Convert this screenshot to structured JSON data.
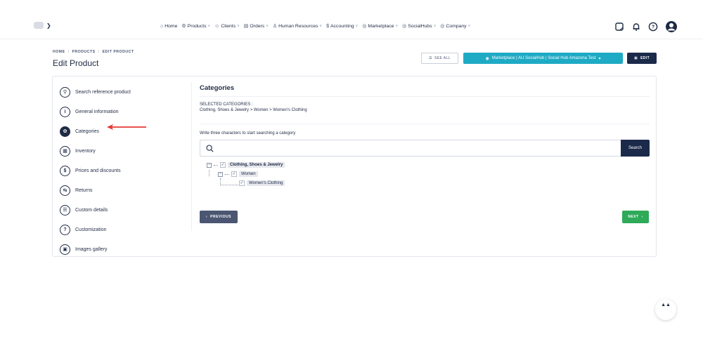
{
  "nav": {
    "items": [
      {
        "label": "Home",
        "icon": "⌂",
        "caret": false
      },
      {
        "label": "Products",
        "icon": "⚙",
        "caret": true
      },
      {
        "label": "Clients",
        "icon": "☺",
        "caret": true
      },
      {
        "label": "Orders",
        "icon": "▤",
        "caret": true
      },
      {
        "label": "Human Resources",
        "icon": "♙",
        "caret": true
      },
      {
        "label": "Accounting",
        "icon": "$",
        "caret": true
      },
      {
        "label": "Marketplace",
        "icon": "◎",
        "caret": true
      },
      {
        "label": "SocialHubs",
        "icon": "◎",
        "caret": true
      },
      {
        "label": "Company",
        "icon": "◎",
        "caret": true
      }
    ]
  },
  "breadcrumb": {
    "home": "HOME",
    "products": "PRODUCTS",
    "current": "EDIT PRODUCT",
    "sep": "/"
  },
  "page": {
    "title": "Edit Product"
  },
  "header_buttons": {
    "see_all": "SEE ALL",
    "marketplace": "Marketplace | AU SocialHub | Social Hub Amazona Test",
    "edit": "EDIT"
  },
  "sidebar": {
    "items": [
      {
        "label": "Search reference product",
        "glyph": "⚲",
        "active": false
      },
      {
        "label": "General information",
        "glyph": "i",
        "active": false
      },
      {
        "label": "Categories",
        "glyph": "✿",
        "active": true
      },
      {
        "label": "Inventory",
        "glyph": "▦",
        "active": false
      },
      {
        "label": "Prices and discounts",
        "glyph": "$",
        "active": false
      },
      {
        "label": "Returns",
        "glyph": "⇆",
        "active": false
      },
      {
        "label": "Custom details",
        "glyph": "☰",
        "active": false
      },
      {
        "label": "Customization",
        "glyph": "?",
        "active": false
      },
      {
        "label": "Images gallery",
        "glyph": "▣",
        "active": false
      }
    ]
  },
  "categories": {
    "title": "Categories",
    "selected_label": "SELECTED CATEGORIES :",
    "selected_path": "Clothing, Shoes & Jewelry > Women > Women's Clothing",
    "hint": "Write three characters to start searching a category",
    "search_value": "",
    "search_button": "Search",
    "tree": {
      "level1": "Clothing, Shoes & Jewelry",
      "level2": "Women",
      "level3": "Women's Clothing"
    },
    "prev_label": "PREVIOUS",
    "next_label": "NEXT"
  },
  "fab": {
    "label": "▲▲"
  },
  "colors": {
    "primary_dark": "#1b2a4a",
    "accent_teal": "#1eaac4",
    "success_green": "#2eaa59",
    "arrow_red": "#e53935"
  }
}
